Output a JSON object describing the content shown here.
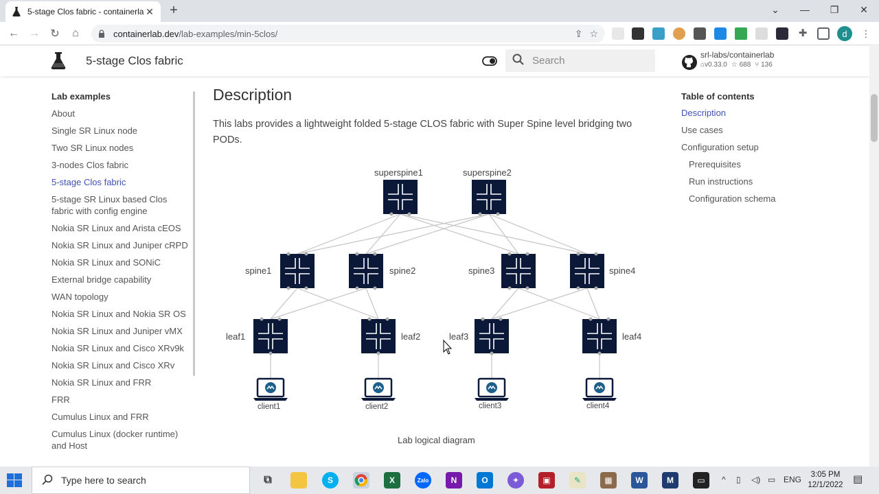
{
  "browser": {
    "tab_title": "5-stage Clos fabric - containerlab",
    "url_host": "containerlab.dev",
    "url_path": "/lab-examples/min-5clos/"
  },
  "site": {
    "title": "5-stage Clos fabric",
    "search_placeholder": "Search",
    "repo_name": "srl-labs/containerlab",
    "repo_version": "v0.33.0",
    "repo_stars": "688",
    "repo_forks": "136"
  },
  "sidebar": {
    "heading": "Lab examples",
    "items": [
      "About",
      "Single SR Linux node",
      "Two SR Linux nodes",
      "3-nodes Clos fabric",
      "5-stage Clos fabric",
      "5-stage SR Linux based Clos fabric with config engine",
      "Nokia SR Linux and Arista cEOS",
      "Nokia SR Linux and Juniper cRPD",
      "Nokia SR Linux and SONiC",
      "External bridge capability",
      "WAN topology",
      "Nokia SR Linux and Nokia SR OS",
      "Nokia SR Linux and Juniper vMX",
      "Nokia SR Linux and Cisco XRv9k",
      "Nokia SR Linux and Cisco XRv",
      "Nokia SR Linux and FRR",
      "FRR",
      "Cumulus Linux and FRR",
      "Cumulus Linux (docker runtime) and Host"
    ],
    "active_index": 4
  },
  "content": {
    "heading": "Description",
    "paragraph": "This labs provides a lightweight folded 5-stage CLOS fabric with Super Spine level bridging two PODs.",
    "caption": "Lab logical diagram"
  },
  "diagram": {
    "superspines": [
      "superspine1",
      "superspine2"
    ],
    "spines": [
      "spine1",
      "spine2",
      "spine3",
      "spine4"
    ],
    "leaves": [
      "leaf1",
      "leaf2",
      "leaf3",
      "leaf4"
    ],
    "clients": [
      "client1",
      "client2",
      "client3",
      "client4"
    ],
    "node_color": "#0b1838",
    "link_color": "#c4c4c4"
  },
  "toc": {
    "heading": "Table of contents",
    "items": [
      {
        "label": "Description",
        "active": true,
        "sub": false
      },
      {
        "label": "Use cases",
        "active": false,
        "sub": false
      },
      {
        "label": "Configuration setup",
        "active": false,
        "sub": false
      },
      {
        "label": "Prerequisites",
        "active": false,
        "sub": true
      },
      {
        "label": "Run instructions",
        "active": false,
        "sub": true
      },
      {
        "label": "Configuration schema",
        "active": false,
        "sub": true
      }
    ]
  },
  "taskbar": {
    "search_text": "Type here to search",
    "language": "ENG",
    "time": "3:05 PM",
    "date": "12/1/2022"
  },
  "colors": {
    "accent": "#4051b5",
    "taskbar": "#e6e8ec"
  }
}
